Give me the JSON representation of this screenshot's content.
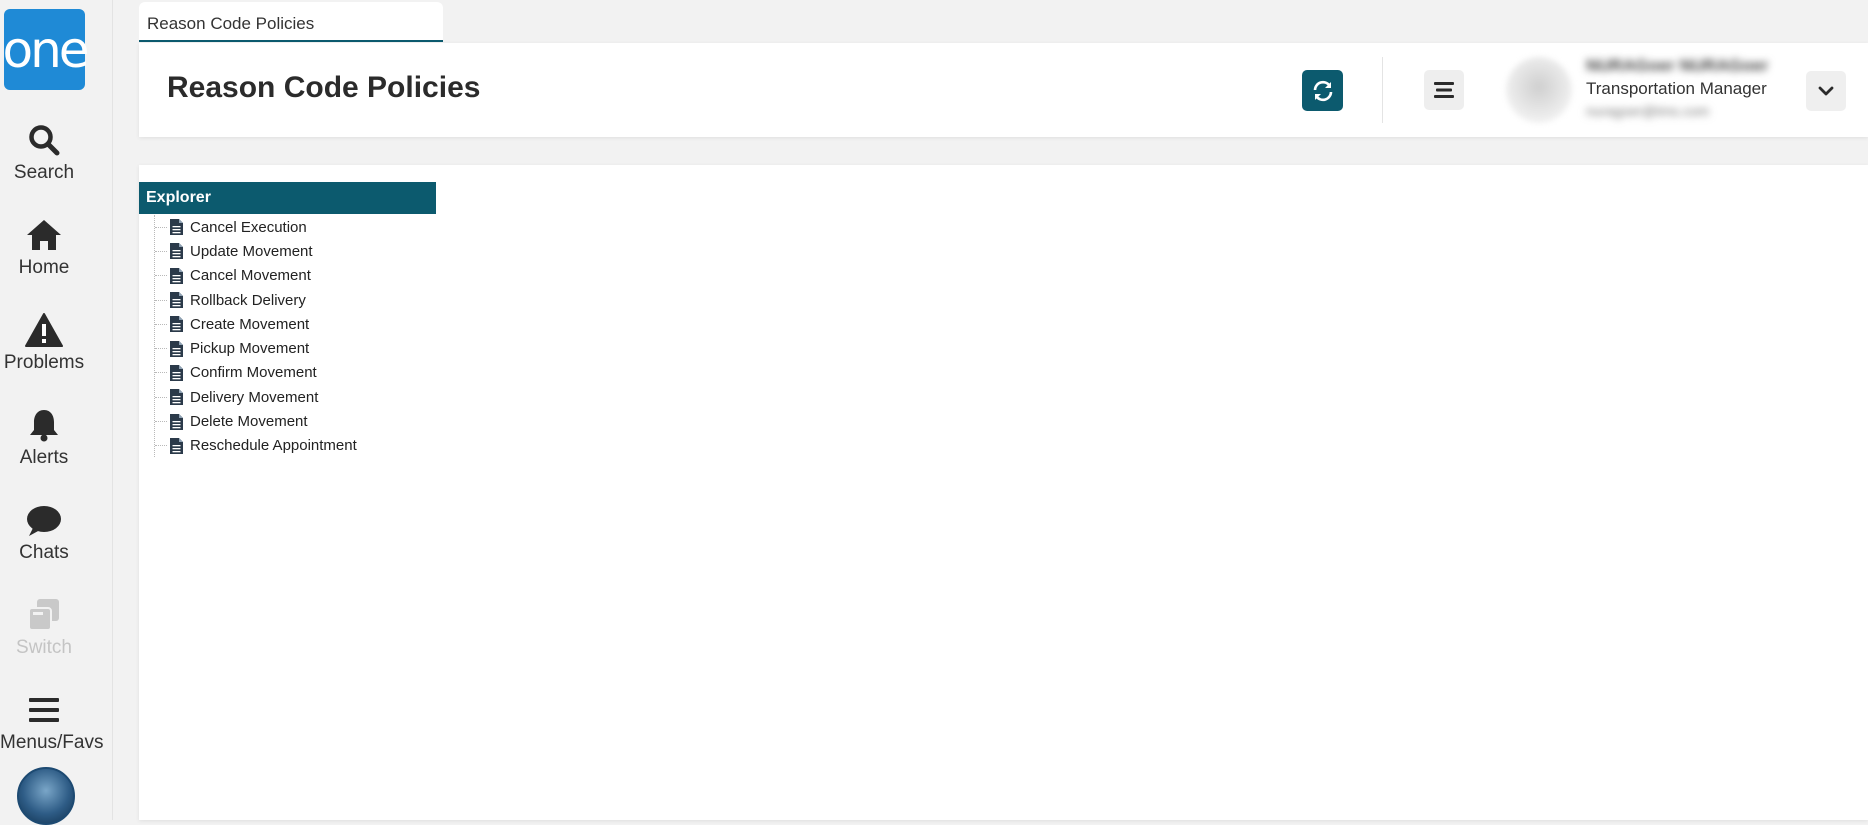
{
  "app": {
    "logo_text": "one",
    "brand_color": "#1f8ad6",
    "accent_color": "#0c5a6e"
  },
  "nav": {
    "items": [
      {
        "label": "Search",
        "icon": "search-icon"
      },
      {
        "label": "Home",
        "icon": "home-icon"
      },
      {
        "label": "Problems",
        "icon": "warning-icon"
      },
      {
        "label": "Alerts",
        "icon": "bell-icon"
      },
      {
        "label": "Chats",
        "icon": "chat-icon"
      },
      {
        "label": "Switch",
        "icon": "switch-icon",
        "disabled": true
      },
      {
        "label": "Menus/Favs",
        "icon": "menu-icon"
      }
    ]
  },
  "tab": {
    "label": "Reason Code Policies"
  },
  "header": {
    "title": "Reason Code Policies",
    "refresh_icon": "refresh-icon",
    "menu_icon": "hamburger-icon",
    "user": {
      "name": "NURAGoer NURAGoer",
      "role": "Transportation Manager",
      "email": "nuragoer@tms.com"
    }
  },
  "explorer": {
    "title": "Explorer",
    "items": [
      "Cancel Execution",
      "Update Movement",
      "Cancel Movement",
      "Rollback Delivery",
      "Create Movement",
      "Pickup Movement",
      "Confirm Movement",
      "Delivery Movement",
      "Delete Movement",
      "Reschedule Appointment"
    ]
  }
}
